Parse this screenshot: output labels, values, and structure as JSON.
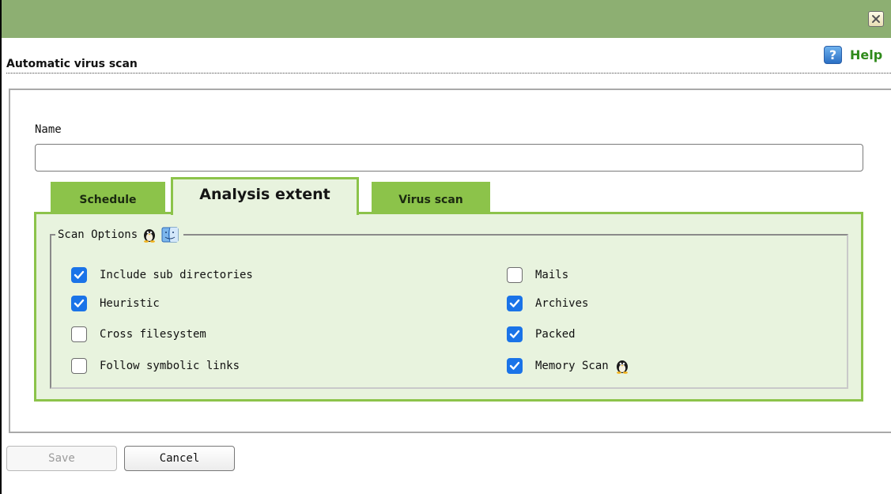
{
  "window": {
    "close_icon": "close-icon"
  },
  "header": {
    "title": "Automatic virus scan",
    "help_label": "Help",
    "help_icon": "help-icon"
  },
  "form": {
    "name_label": "Name",
    "name_value": "",
    "name_placeholder": ""
  },
  "tabs": [
    {
      "label": "Schedule",
      "active": false
    },
    {
      "label": "Analysis extent",
      "active": true
    },
    {
      "label": "Virus scan",
      "active": false
    }
  ],
  "scan_options": {
    "legend": "Scan Options",
    "legend_icons": [
      "linux-tux-icon",
      "mac-finder-icon"
    ],
    "left": [
      {
        "label": "Include sub directories",
        "checked": true
      },
      {
        "label": "Heuristic",
        "checked": true
      },
      {
        "label": "Cross filesystem",
        "checked": false
      },
      {
        "label": "Follow symbolic links",
        "checked": false
      }
    ],
    "right": [
      {
        "label": "Mails",
        "checked": false
      },
      {
        "label": "Archives",
        "checked": true
      },
      {
        "label": "Packed",
        "checked": true
      },
      {
        "label": "Memory Scan",
        "checked": true,
        "icon": "linux-tux-icon"
      }
    ]
  },
  "buttons": {
    "save_label": "Save",
    "save_enabled": false,
    "cancel_label": "Cancel"
  },
  "colors": {
    "titlebar": "#8daf72",
    "tab_green": "#8cc34a",
    "panel_bg": "#e8f3de",
    "checkbox_blue": "#1a73e8",
    "help_green": "#2f8a1b"
  }
}
